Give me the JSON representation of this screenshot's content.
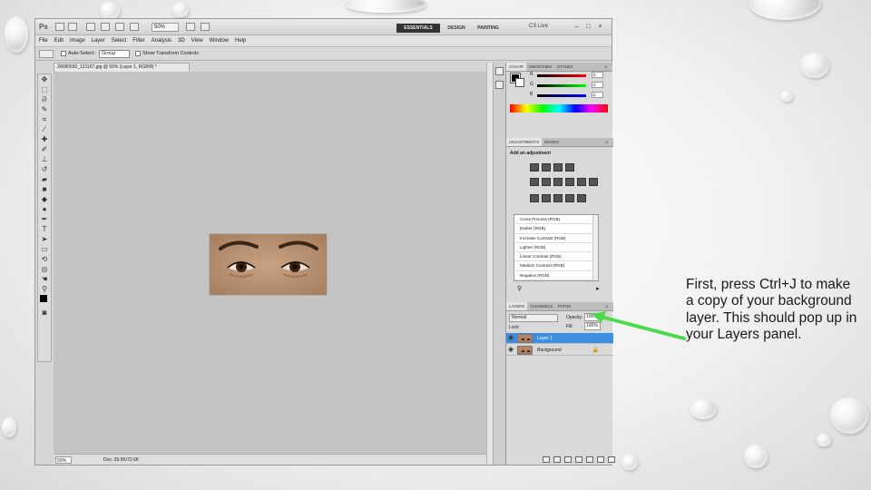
{
  "ps": {
    "logo": "Ps",
    "zoom": "50%",
    "workspaces": [
      "ESSENTIALS",
      "DESIGN",
      "PAINTING"
    ],
    "cs_live": "CS Live",
    "win_min": "–",
    "win_max": "□",
    "win_close": "×"
  },
  "menu": [
    "File",
    "Edit",
    "Image",
    "Layer",
    "Select",
    "Filter",
    "Analysis",
    "3D",
    "View",
    "Window",
    "Help"
  ],
  "options": {
    "auto_select_label": "Auto-Select:",
    "auto_select_value": "Group",
    "show_transform": "Show Transform Controls"
  },
  "document": {
    "tab_title": "20080930_131167.jpg @ 50% (Layer 1, RGB/8) *",
    "status_zoom": "50%",
    "status_doc": "Doc: 35.5K/72.6K"
  },
  "panels": {
    "color_tabs": [
      "COLOR",
      "SWATCHES",
      "STYLES"
    ],
    "color_rows": [
      {
        "k": "R",
        "v": "0",
        "bar_from": "#000000",
        "bar_to": "#ff0000"
      },
      {
        "k": "G",
        "v": "0",
        "bar_from": "#000000",
        "bar_to": "#00ff00"
      },
      {
        "k": "B",
        "v": "0",
        "bar_from": "#000000",
        "bar_to": "#0000ff"
      }
    ],
    "adj_tabs": [
      "ADJUSTMENTS",
      "MASKS"
    ],
    "adj_title": "Add an adjustment",
    "presets": [
      "Cross Process (RGB)",
      "Darker (RGB)",
      "Increase Contrast (RGB)",
      "Lighter (RGB)",
      "Linear Contrast (RGB)",
      "Medium Contrast (RGB)",
      "Negative (RGB)"
    ],
    "layers_tabs": [
      "LAYERS",
      "CHANNELS",
      "PATHS"
    ],
    "blend_mode": "Normal",
    "opacity_label": "Opacity:",
    "opacity_value": "100%",
    "fill_label": "Fill:",
    "fill_value": "100%",
    "lock_label": "Lock:",
    "layers": [
      {
        "name": "Layer 1",
        "selected": true
      },
      {
        "name": "Background",
        "selected": false
      }
    ]
  },
  "annotation": {
    "text": "First, press Ctrl+J to make a copy of your background layer. This should pop up in your Layers panel.",
    "arrow_color": "#4cd94c"
  }
}
